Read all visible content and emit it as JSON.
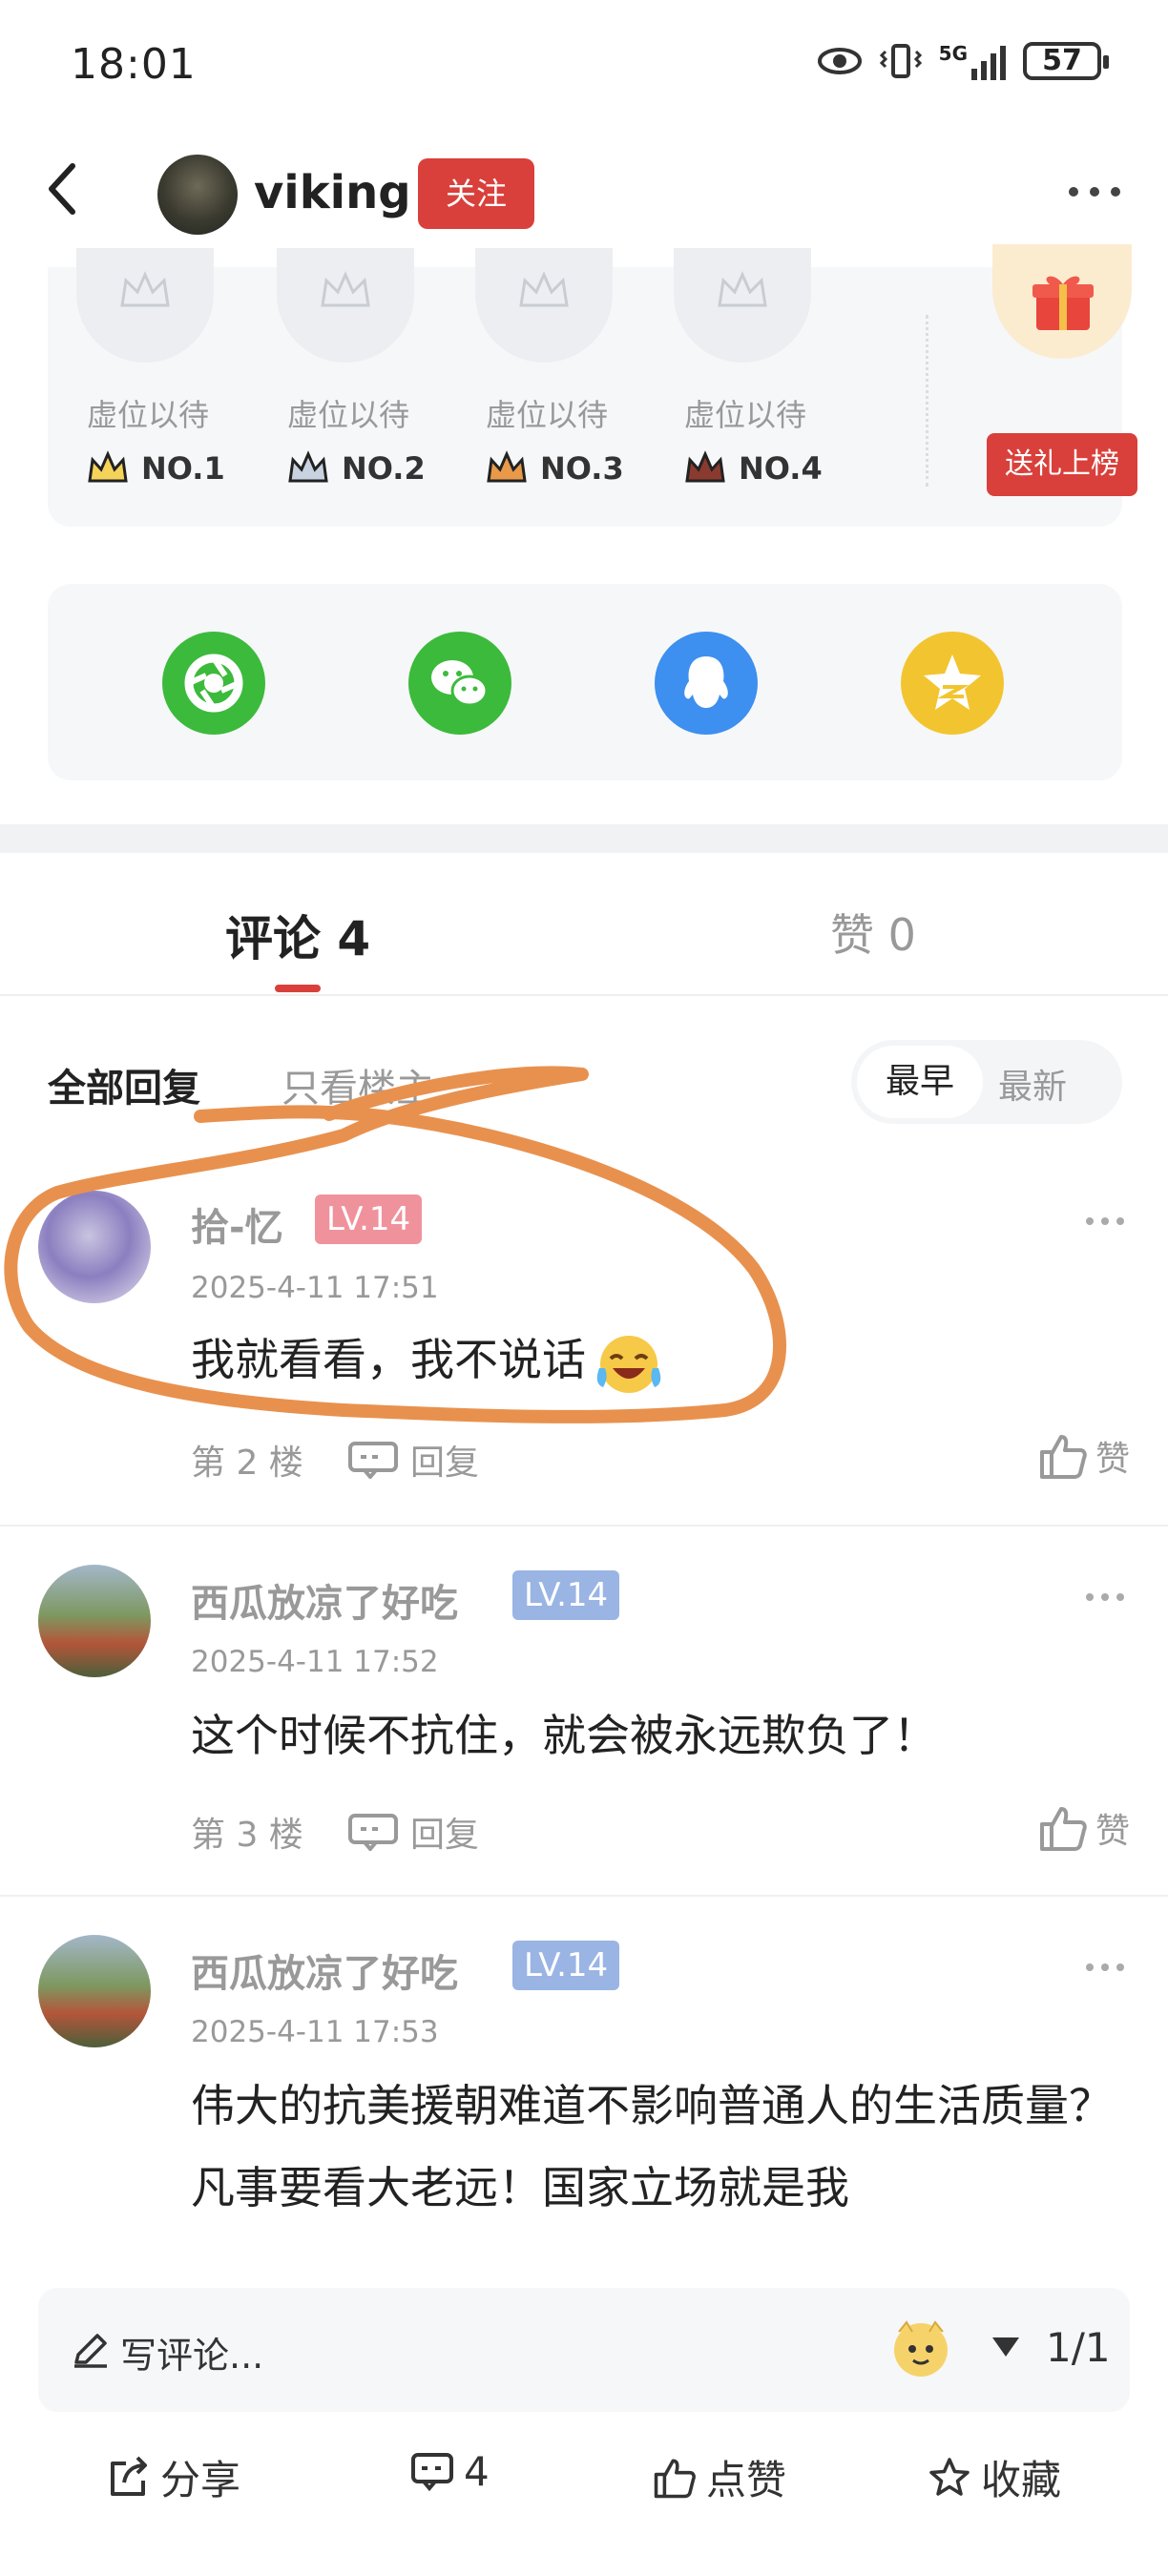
{
  "status_bar": {
    "time": "18:01",
    "battery": "57",
    "network": "5G"
  },
  "header": {
    "username": "viking",
    "follow_label": "关注"
  },
  "rank": {
    "slots": [
      {
        "label": "虚位以待",
        "no": "NO.1",
        "color": "#e8b83a"
      },
      {
        "label": "虚位以待",
        "no": "NO.2",
        "color": "#8c96a8"
      },
      {
        "label": "虚位以待",
        "no": "NO.3",
        "color": "#d98b3a"
      },
      {
        "label": "虚位以待",
        "no": "NO.4",
        "color": "#7a3b2e"
      }
    ],
    "gift_button": "送礼上榜"
  },
  "share_icons": [
    {
      "name": "moments-icon",
      "color": "#3cba3c"
    },
    {
      "name": "wechat-icon",
      "color": "#3cba3c"
    },
    {
      "name": "qq-icon",
      "color": "#3d8ff0"
    },
    {
      "name": "qzone-icon",
      "color": "#f2c530"
    }
  ],
  "tabs": {
    "comments": "评论 4",
    "likes": "赞 0"
  },
  "filter": {
    "all": "全部回复",
    "op_only": "只看楼主",
    "sort_earliest": "最早",
    "sort_newest": "最新"
  },
  "comments": [
    {
      "name": "拾-忆",
      "level": "LV.14",
      "level_color": "#f0929c",
      "date": "2025-4-11 17:51",
      "text": "我就看看，我不说话",
      "floor": "第 2 楼",
      "reply": "回复",
      "like": "赞"
    },
    {
      "name": "西瓜放凉了好吃",
      "level": "LV.14",
      "level_color": "#9ab4e4",
      "date": "2025-4-11 17:52",
      "text": "这个时候不抗住，就会被永远欺负了！",
      "floor": "第 3 楼",
      "reply": "回复",
      "like": "赞"
    },
    {
      "name": "西瓜放凉了好吃",
      "level": "LV.14",
      "level_color": "#9ab4e4",
      "date": "2025-4-11 17:53",
      "text": "伟大的抗美援朝难道不影响普通人的生活质量？凡事要看大老远！国家立场就是我"
    }
  ],
  "bottom": {
    "input_placeholder": "写评论...",
    "page": "1/1",
    "share": "分享",
    "comment_count": "4",
    "like": "点赞",
    "favorite": "收藏"
  },
  "annotation_color": "#e8914e"
}
